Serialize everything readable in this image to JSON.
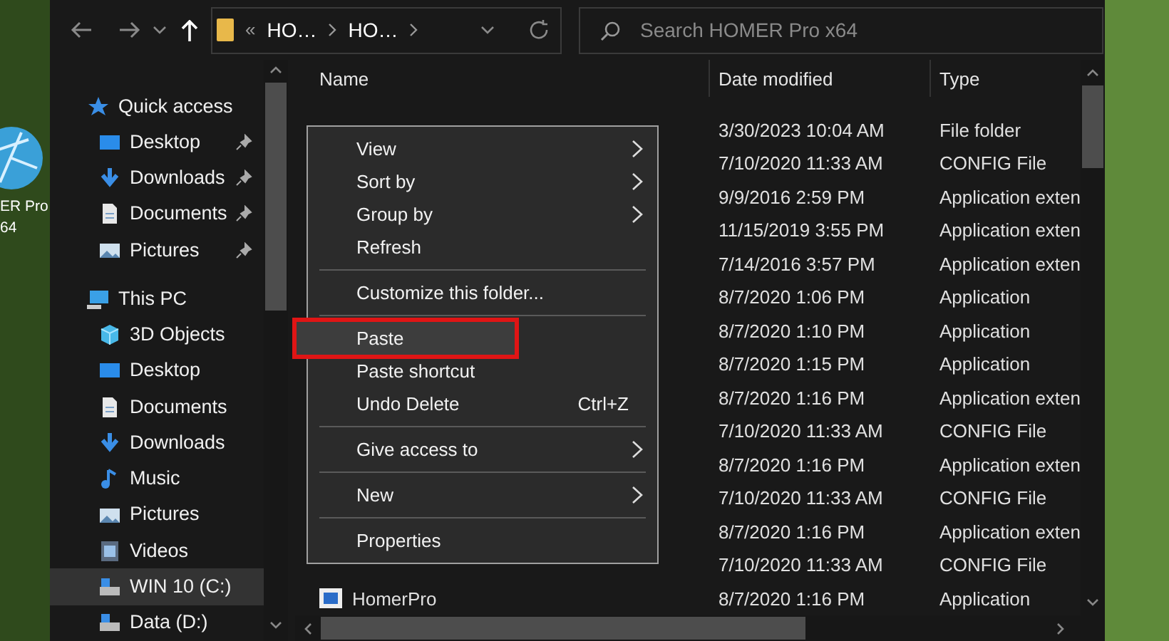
{
  "desktop": {
    "icon_label": [
      "ER Pro",
      "64"
    ]
  },
  "address": {
    "overflow": "«",
    "segments": [
      "HO…",
      "HO…"
    ]
  },
  "search": {
    "placeholder": "Search HOMER Pro x64"
  },
  "columns": [
    "Name",
    "Date modified",
    "Type"
  ],
  "sidebar": [
    {
      "label": "Quick access",
      "kind": "star",
      "group": true,
      "pinned": false,
      "selected": false
    },
    {
      "label": "Desktop",
      "kind": "desktop",
      "group": false,
      "pinned": true,
      "selected": false
    },
    {
      "label": "Downloads",
      "kind": "download",
      "group": false,
      "pinned": true,
      "selected": false
    },
    {
      "label": "Documents",
      "kind": "document",
      "group": false,
      "pinned": true,
      "selected": false
    },
    {
      "label": "Pictures",
      "kind": "picture",
      "group": false,
      "pinned": true,
      "selected": false
    },
    {
      "label": "This PC",
      "kind": "pc",
      "group": true,
      "pinned": false,
      "selected": false
    },
    {
      "label": "3D Objects",
      "kind": "cube",
      "group": false,
      "pinned": false,
      "selected": false
    },
    {
      "label": "Desktop",
      "kind": "desktop",
      "group": false,
      "pinned": false,
      "selected": false
    },
    {
      "label": "Documents",
      "kind": "document",
      "group": false,
      "pinned": false,
      "selected": false
    },
    {
      "label": "Downloads",
      "kind": "download",
      "group": false,
      "pinned": false,
      "selected": false
    },
    {
      "label": "Music",
      "kind": "music",
      "group": false,
      "pinned": false,
      "selected": false
    },
    {
      "label": "Pictures",
      "kind": "picture",
      "group": false,
      "pinned": false,
      "selected": false
    },
    {
      "label": "Videos",
      "kind": "video",
      "group": false,
      "pinned": false,
      "selected": false
    },
    {
      "label": "WIN 10 (C:)",
      "kind": "drive",
      "group": false,
      "pinned": false,
      "selected": true
    },
    {
      "label": "Data (D:)",
      "kind": "drive",
      "group": false,
      "pinned": false,
      "selected": false
    }
  ],
  "rows": [
    {
      "date": "3/30/2023 10:04 AM",
      "type": "File folder"
    },
    {
      "date": "7/10/2020 11:33 AM",
      "type": "CONFIG File"
    },
    {
      "date": "9/9/2016 2:59 PM",
      "type": "Application exten"
    },
    {
      "date": "11/15/2019 3:55 PM",
      "type": "Application exten"
    },
    {
      "date": "7/14/2016 3:57 PM",
      "type": "Application exten"
    },
    {
      "date": "8/7/2020 1:06 PM",
      "type": "Application"
    },
    {
      "date": "8/7/2020 1:10 PM",
      "type": "Application"
    },
    {
      "date": "8/7/2020 1:15 PM",
      "type": "Application"
    },
    {
      "date": "8/7/2020 1:16 PM",
      "type": "Application exten"
    },
    {
      "date": "7/10/2020 11:33 AM",
      "type": "CONFIG File"
    },
    {
      "date": "8/7/2020 1:16 PM",
      "type": "Application exten"
    },
    {
      "date": "7/10/2020 11:33 AM",
      "type": "CONFIG File"
    },
    {
      "date": "8/7/2020 1:16 PM",
      "type": "Application exten"
    },
    {
      "date": "7/10/2020 11:33 AM",
      "type": "CONFIG File"
    },
    {
      "name": "HomerPro",
      "date": "8/7/2020 1:16 PM",
      "type": "Application"
    }
  ],
  "context_menu": [
    {
      "kind": "item",
      "label": "View",
      "submenu": true,
      "selected": false
    },
    {
      "kind": "item",
      "label": "Sort by",
      "submenu": true,
      "selected": false
    },
    {
      "kind": "item",
      "label": "Group by",
      "submenu": true,
      "selected": false
    },
    {
      "kind": "item",
      "label": "Refresh",
      "submenu": false,
      "selected": false
    },
    {
      "kind": "separator"
    },
    {
      "kind": "item",
      "label": "Customize this folder...",
      "submenu": false,
      "selected": false
    },
    {
      "kind": "separator"
    },
    {
      "kind": "item",
      "label": "Paste",
      "submenu": false,
      "selected": true
    },
    {
      "kind": "item",
      "label": "Paste shortcut",
      "submenu": false,
      "selected": false
    },
    {
      "kind": "item",
      "label": "Undo Delete",
      "shortcut": "Ctrl+Z",
      "submenu": false,
      "selected": false
    },
    {
      "kind": "separator"
    },
    {
      "kind": "item",
      "label": "Give access to",
      "submenu": true,
      "selected": false
    },
    {
      "kind": "separator"
    },
    {
      "kind": "item",
      "label": "New",
      "submenu": true,
      "selected": false
    },
    {
      "kind": "separator"
    },
    {
      "kind": "item",
      "label": "Properties",
      "submenu": false,
      "selected": false
    }
  ]
}
